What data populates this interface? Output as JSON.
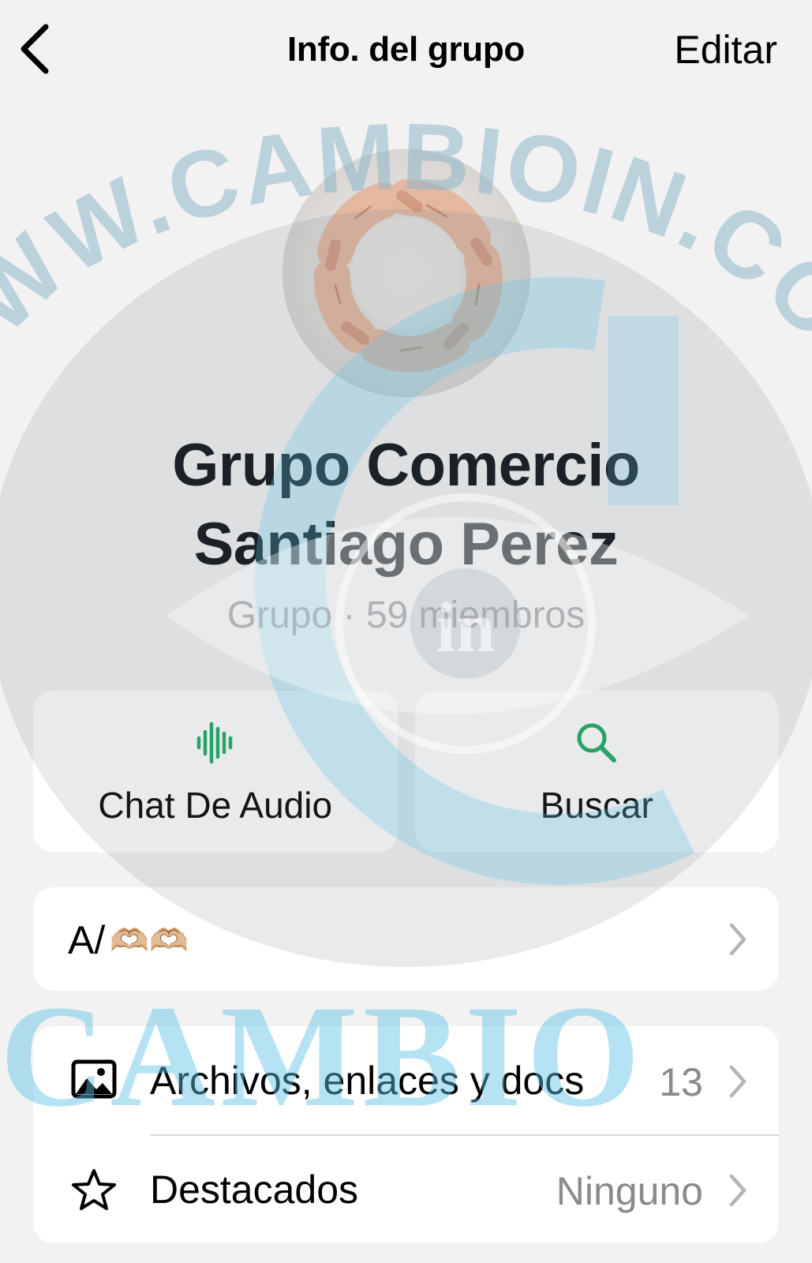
{
  "header": {
    "title": "Info. del grupo",
    "edit_label": "Editar"
  },
  "group": {
    "name_line1": "Grupo Comercio",
    "name_line2": "Santiago Perez",
    "meta": "Grupo · 59 miembros"
  },
  "actions": [
    {
      "label": "Chat De Audio",
      "icon": "audio-waveform-icon"
    },
    {
      "label": "Buscar",
      "icon": "search-icon"
    }
  ],
  "description": {
    "text": "A/",
    "emoji": "🫶🏼🫶🏼"
  },
  "list": [
    {
      "label": "Archivos, enlaces y docs",
      "value": "13",
      "icon": "photo-icon"
    },
    {
      "label": "Destacados",
      "value": "Ninguno",
      "icon": "star-icon"
    }
  ],
  "watermark": {
    "arc_text": "WWW.CAMBIOIN.COM",
    "brand_text": "CAMBIO",
    "suffix": "in"
  },
  "colors": {
    "accent": "#1daa61",
    "secondary_text": "#8a8a8e",
    "watermark_blue": "#5fc3e6",
    "watermark_gray": "#9aa2aa"
  }
}
